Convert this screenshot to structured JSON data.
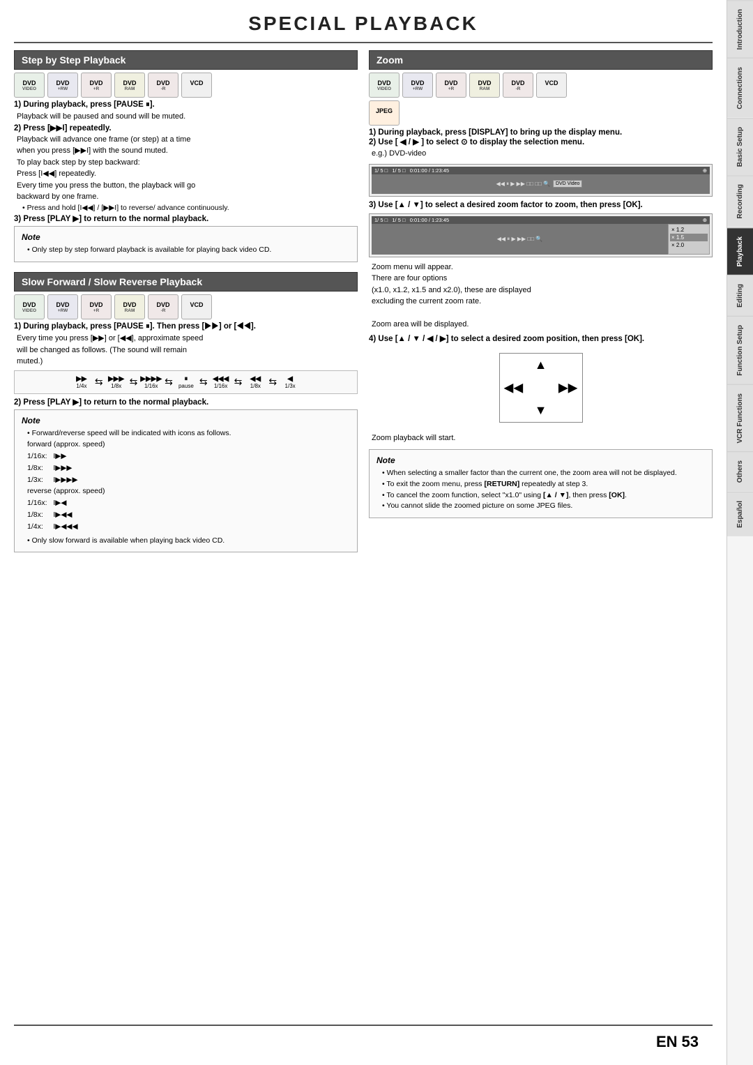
{
  "page": {
    "title": "SPECIAL PLAYBACK",
    "page_number": "53",
    "page_en": "EN"
  },
  "sidebar": {
    "tabs": [
      {
        "label": "Introduction",
        "active": false
      },
      {
        "label": "Connections",
        "active": false
      },
      {
        "label": "Basic Setup",
        "active": false
      },
      {
        "label": "Recording",
        "active": false
      },
      {
        "label": "Playback",
        "active": true
      },
      {
        "label": "Editing",
        "active": false
      },
      {
        "label": "Function Setup",
        "active": false
      },
      {
        "label": "VCR Functions",
        "active": false
      },
      {
        "label": "Others",
        "active": false
      },
      {
        "label": "Español",
        "active": false
      }
    ]
  },
  "step_playback": {
    "title": "Step by Step Playback",
    "disc_icons": [
      {
        "label": "DVD",
        "sub": "VIDEO",
        "type": "dvd"
      },
      {
        "label": "DVD",
        "sub": "+RW",
        "type": "dvdrw"
      },
      {
        "label": "DVD",
        "sub": "+R",
        "type": "dvdr"
      },
      {
        "label": "DVD",
        "sub": "RAM",
        "type": "dvdram"
      },
      {
        "label": "DVD",
        "sub": "-R",
        "type": "dvdr2"
      },
      {
        "label": "VCD",
        "sub": "",
        "type": "vcd"
      }
    ],
    "steps": [
      {
        "number": "1)",
        "title": "During playback, press [PAUSE II].",
        "body": "Playback will be paused and sound will be muted."
      },
      {
        "number": "2)",
        "title": "Press [▶▶I] repeatedly.",
        "body": "Playback will advance one frame (or step) at a time\nwhen you press [▶▶I] with the sound muted.\nTo play back step by step backward:\nPress [I◀◀] repeatedly.\nEvery time you press the button, the playback will go\nbackward by one frame.\n• Press and hold [I◀◀] / [▶▶I] to reverse/ advance\ncontinuously."
      },
      {
        "number": "3)",
        "title": "Press [PLAY ▶] to return to the normal playback.",
        "body": ""
      }
    ],
    "note": {
      "title": "Note",
      "items": [
        "Only step by step forward playback is available for playing back video CD."
      ]
    }
  },
  "slow_playback": {
    "title": "Slow Forward / Slow Reverse Playback",
    "disc_icons": [
      {
        "label": "DVD",
        "sub": "VIDEO",
        "type": "dvd"
      },
      {
        "label": "DVD",
        "sub": "+RW",
        "type": "dvdrw"
      },
      {
        "label": "DVD",
        "sub": "+R",
        "type": "dvdr"
      },
      {
        "label": "DVD",
        "sub": "RAM",
        "type": "dvdram"
      },
      {
        "label": "DVD",
        "sub": "-R",
        "type": "dvdr2"
      },
      {
        "label": "VCD",
        "sub": "",
        "type": "vcd"
      }
    ],
    "step1_title": "1) During playback, press [PAUSE II]. Then press\n[▶▶] or [◀◀].",
    "step1_body": "Every time you press [▶▶] or [◀◀], approximate speed\nwill be changed as follows. (The sound will remain\nmuted.)",
    "speed_items": [
      {
        "label": "1/4x",
        "icon": "▶▶"
      },
      {
        "label": "1/8x",
        "icon": "▶▶▶"
      },
      {
        "label": "1/16x",
        "icon": "▶▶▶▶"
      },
      {
        "label": "pause",
        "icon": ""
      },
      {
        "label": "1/16x",
        "icon": "◀◀◀"
      },
      {
        "label": "1/8x",
        "icon": "◀◀"
      },
      {
        "label": "1/3x",
        "icon": "◀"
      }
    ],
    "step2_title": "2) Press [PLAY ▶] to return to the normal playback.",
    "note": {
      "title": "Note",
      "items": [
        "Forward/reverse speed will be indicated with icons as follows.",
        "forward (approx. speed)",
        "1/16x:  I▶▶",
        "1/8x:   I▶▶▶",
        "1/3x:   I▶▶▶▶",
        "reverse (approx. speed)",
        "1/16x:  I▶◀",
        "1/8x:   I▶◀◀",
        "1/4x:   I▶◀◀◀",
        "Only slow forward is available when playing back video CD."
      ]
    }
  },
  "zoom": {
    "title": "Zoom",
    "disc_icons": [
      {
        "label": "DVD",
        "sub": "VIDEO",
        "type": "dvd"
      },
      {
        "label": "DVD",
        "sub": "+RW",
        "type": "dvdrw"
      },
      {
        "label": "DVD",
        "sub": "+R",
        "type": "dvdr"
      },
      {
        "label": "DVD",
        "sub": "RAM",
        "type": "dvdram"
      },
      {
        "label": "DVD",
        "sub": "-R",
        "type": "dvdr2"
      },
      {
        "label": "VCD",
        "sub": "",
        "type": "vcd"
      },
      {
        "label": "JPEG",
        "sub": "",
        "type": "jpeg"
      }
    ],
    "step1_title": "1) During playback, press [DISPLAY] to bring up the display menu.",
    "step2_title": "2) Use [ ◀ / ▶ ] to select  to display the selection menu.",
    "step2_sub": "e.g.) DVD-video",
    "step3_title": "3) Use [▲ / ▼] to select a desired zoom factor to zoom, then press [OK].",
    "step3_notes": [
      "Zoom menu will appear.",
      "There are four options",
      "(x1.0, x1.2, x1.5 and x2.0), these are displayed excluding the current zoom rate.",
      "",
      "Zoom area will be displayed."
    ],
    "step4_title": "4) Use [▲ / ▼ / ◀ / ▶] to select a desired zoom position, then press [OK].",
    "step4_notes": [
      "Zoom playback will start."
    ],
    "note": {
      "title": "Note",
      "items": [
        "When selecting a smaller factor than the current one, the zoom area will not be displayed.",
        "To exit the zoom menu, press [RETURN] repeatedly at step 3.",
        "To cancel the zoom function, select \"x1.0\" using [▲ / ▼], then press [OK].",
        "You cannot slide the zoomed picture on some JPEG files."
      ]
    }
  }
}
